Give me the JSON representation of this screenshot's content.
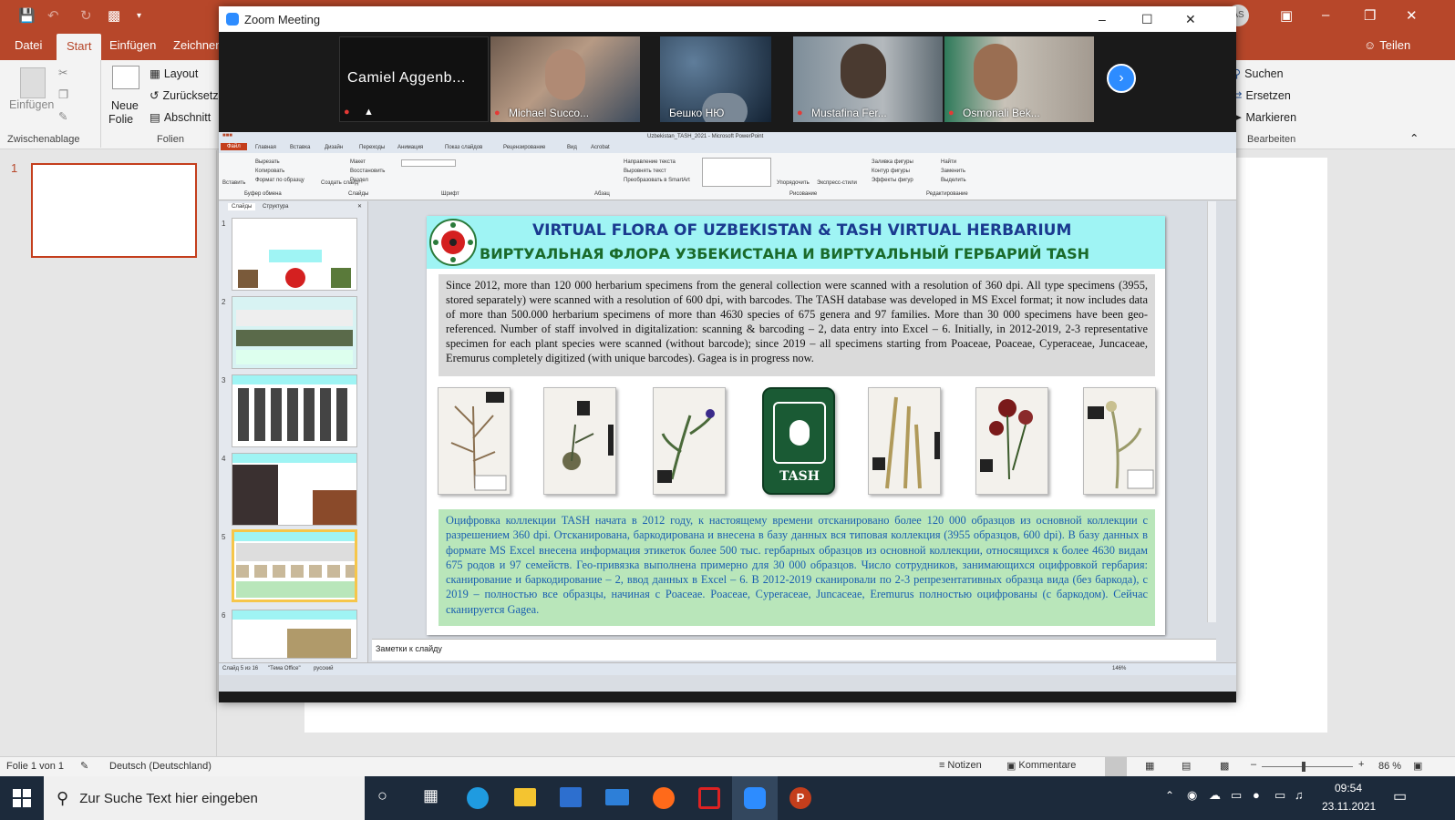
{
  "ppt": {
    "tabs": [
      "Datei",
      "Start",
      "Einfügen",
      "Zeichnen"
    ],
    "share": "Teilen",
    "user_initials": "AS",
    "clipboard": {
      "paste": "Einfügen",
      "group": "Zwischenablage"
    },
    "slides_group": {
      "new_slide_line1": "Neue",
      "new_slide_line2": "Folie",
      "layout": "Layout",
      "reset": "Zurücksetz",
      "section": "Abschnitt",
      "group": "Folien"
    },
    "editing": {
      "find": "Suchen",
      "replace": "Ersetzen",
      "select": "Markieren",
      "group": "Bearbeiten"
    },
    "thumb_number": "1",
    "status": {
      "slide_info": "Folie 1 von 1",
      "language": "Deutsch (Deutschland)",
      "notes": "Notizen",
      "comments": "Kommentare",
      "zoom": "86 %"
    }
  },
  "zoom": {
    "title": "Zoom Meeting",
    "participants": [
      {
        "name": "Camiel  Aggenb..."
      },
      {
        "name": "Michael Succo..."
      },
      {
        "name": "Бешко НЮ"
      },
      {
        "name": "Mustafina Fer..."
      },
      {
        "name": "Osmonali Bek..."
      }
    ]
  },
  "shared": {
    "title_bar": "Uzbekistan_TASH_2021 - Microsoft PowerPoint",
    "tabs": [
      "Файл",
      "Главная",
      "Вставка",
      "Дизайн",
      "Переходы",
      "Анимация",
      "Показ слайдов",
      "Рецензирование",
      "Вид",
      "Acrobat"
    ],
    "panel_tabs": [
      "Слайды",
      "Структура"
    ],
    "ribbon_groups": [
      "Буфер обмена",
      "Слайды",
      "Шрифт",
      "Абзац",
      "Рисование",
      "Редактирование"
    ],
    "ribbon_items": [
      "Вырезать",
      "Копировать",
      "Формат по образцу",
      "Макет",
      "Восстановить",
      "Раздел",
      "Создать слайд",
      "Вставить",
      "Направление текста",
      "Выровнять текст",
      "Преобразовать в SmartArt",
      "Заливка фигуры",
      "Контур фигуры",
      "Эффекты фигур",
      "Найти",
      "Заменить",
      "Выделить",
      "Упорядочить",
      "Экспресс-стили"
    ],
    "notes_placeholder": "Заметки к слайду",
    "status": [
      "Слайд 5 из 16",
      "\"Тема Office\"",
      "русский"
    ],
    "zoom_pct": "146%",
    "slide": {
      "title_en": "VIRTUAL FLORA OF UZBEKISTAN & TASH VIRTUAL HERBARIUM",
      "title_ru": "ВИРТУАЛЬНАЯ ФЛОРА УЗБЕКИСТАНА И ВИРТУАЛЬНЫЙ ГЕРБАРИЙ TASH",
      "para_en": "Since 2012, more than 120 000 herbarium specimens from the general collection were scanned with a resolution of 360 dpi. All type specimens (3955, stored separately) were scanned with a resolution of 600 dpi, with barcodes. The TASH database was developed in MS Excel format; it now includes data of more than 500.000 herbarium specimens of more than 4630 species of 675 genera and 97 families. More than 30 000 specimens have been geo-referenced. Number of staff involved in digitalization: scanning & barcoding – 2, data entry into Excel – 6. Initially, in 2012-2019, 2-3 representative specimen for each plant species were scanned (without barcode); since 2019 – all specimens starting from Poaceae, Poaceae, Cyperaceae, Juncaceae, Eremurus completely digitized (with unique barcodes). Gagea is in progress now.",
      "para_ru": "Оцифровка коллекции TASH начата в 2012 году, к настоящему времени отсканировано более 120 000 образцов из основной коллекции с разрешением 360 dpi. Отсканирована, баркодирована и внесена в базу данных вся типовая коллекция (3955 образцов, 600 dpi). В базу данных в формате MS Excel внесена информация этикеток более 500 тыс. гербарных образцов из основной коллекции, относящихся к более 4630 видам 675 родов и 97 семейств. Гео-привязка выполнена примерно для 30 000 образцов. Число сотрудников, занимающихся оцифровкой гербария: сканирование и баркодирование – 2, ввод данных в Excel – 6. В 2012-2019 сканировали по 2-3 репрезентативных образца вида (без баркода), с 2019 – полностью все образцы, начиная с Poaceae. Poaceae, Cyperaceae, Juncaceae, Eremurus полностью оцифрованы (с баркодом). Сейчас сканируется Gagea.",
      "logo_text": "TASH"
    },
    "thumb_numbers": [
      "1",
      "2",
      "3",
      "4",
      "5",
      "6"
    ]
  },
  "taskbar": {
    "search_placeholder": "Zur Suche Text hier eingeben",
    "time": "09:54",
    "date": "23.11.2021"
  },
  "colors": {
    "ppt_red": "#b7472a",
    "zoom_blue": "#2d8cff",
    "slide_header": "#9ff4f4",
    "slide_title": "#1a3a8f",
    "ru_box": "#b9e6ba",
    "ru_text": "#1a5fb0"
  }
}
